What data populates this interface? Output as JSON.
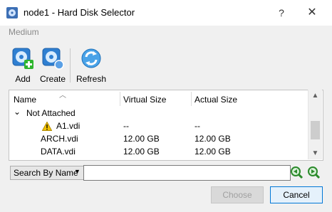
{
  "window": {
    "title": "node1 - Hard Disk Selector",
    "help": "?",
    "close": "✕"
  },
  "section_label": "Medium",
  "toolbar": {
    "add": "Add",
    "create": "Create",
    "refresh": "Refresh"
  },
  "table": {
    "headers": {
      "name": "Name",
      "virtual_size": "Virtual Size",
      "actual_size": "Actual Size"
    },
    "group": {
      "label": "Not Attached",
      "chevron": "⌄"
    },
    "rows": [
      {
        "name": "A1.vdi",
        "virtual_size": "--",
        "actual_size": "--",
        "warning": true
      },
      {
        "name": "ARCH.vdi",
        "virtual_size": "12.00 GB",
        "actual_size": "12.00 GB"
      },
      {
        "name": "DATA.vdi",
        "virtual_size": "12.00 GB",
        "actual_size": "12.00 GB"
      }
    ]
  },
  "search": {
    "mode": "Search By Name",
    "value": ""
  },
  "buttons": {
    "choose": "Choose",
    "cancel": "Cancel"
  }
}
